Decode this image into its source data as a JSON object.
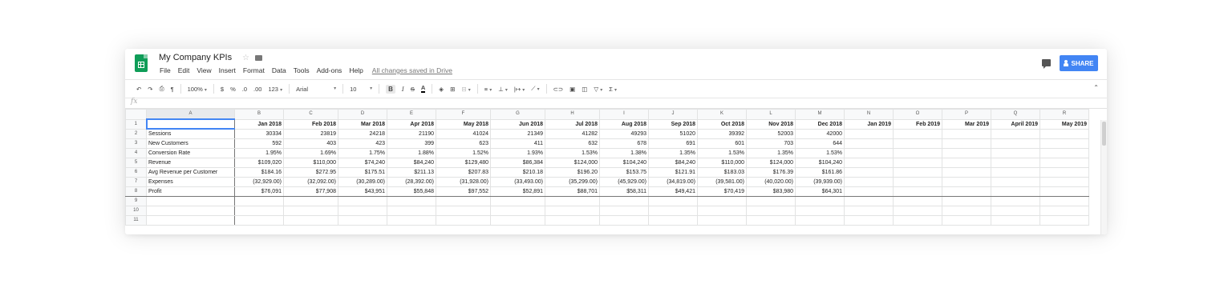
{
  "doc": {
    "title": "My Company KPIs",
    "saved": "All changes saved in Drive"
  },
  "menu": [
    "File",
    "Edit",
    "View",
    "Insert",
    "Format",
    "Data",
    "Tools",
    "Add-ons",
    "Help"
  ],
  "share_label": "SHARE",
  "toolbar": {
    "zoom": "100%",
    "currency": "$",
    "percent": "%",
    "dec_dec": ".0",
    "dec_inc": ".00",
    "more_formats": "123",
    "font": "Arial",
    "font_size": "10",
    "bold": "B",
    "italic": "I",
    "strike": "S",
    "text_color": "A",
    "sum": "Σ"
  },
  "fx_label": "fx",
  "columns": [
    "A",
    "B",
    "C",
    "D",
    "E",
    "F",
    "G",
    "H",
    "I",
    "J",
    "K",
    "L",
    "M",
    "N",
    "O",
    "P",
    "Q",
    "R"
  ],
  "row_numbers": [
    "1",
    "2",
    "3",
    "4",
    "5",
    "6",
    "7",
    "8",
    "9",
    "10",
    "11"
  ],
  "rows": [
    [
      "",
      "Jan 2018",
      "Feb 2018",
      "Mar 2018",
      "Apr 2018",
      "May 2018",
      "Jun 2018",
      "Jul 2018",
      "Aug 2018",
      "Sep 2018",
      "Oct 2018",
      "Nov 2018",
      "Dec 2018",
      "Jan 2019",
      "Feb 2019",
      "Mar 2019",
      "April 2019",
      "May 2019"
    ],
    [
      "Sessions",
      "30334",
      "23819",
      "24218",
      "21190",
      "41024",
      "21349",
      "41282",
      "49293",
      "51020",
      "39392",
      "52003",
      "42000",
      "",
      "",
      "",
      "",
      ""
    ],
    [
      "New Customers",
      "592",
      "403",
      "423",
      "399",
      "623",
      "411",
      "632",
      "678",
      "691",
      "601",
      "703",
      "644",
      "",
      "",
      "",
      "",
      ""
    ],
    [
      "Conversion Rate",
      "1.95%",
      "1.69%",
      "1.75%",
      "1.88%",
      "1.52%",
      "1.93%",
      "1.53%",
      "1.38%",
      "1.35%",
      "1.53%",
      "1.35%",
      "1.53%",
      "",
      "",
      "",
      "",
      ""
    ],
    [
      "Revenue",
      "$109,020",
      "$110,000",
      "$74,240",
      "$84,240",
      "$129,480",
      "$86,384",
      "$124,000",
      "$104,240",
      "$84,240",
      "$110,000",
      "$124,000",
      "$104,240",
      "",
      "",
      "",
      "",
      ""
    ],
    [
      "Avg Revenue per Customer",
      "$184.16",
      "$272.95",
      "$175.51",
      "$211.13",
      "$207.83",
      "$210.18",
      "$196.20",
      "$153.75",
      "$121.91",
      "$183.03",
      "$176.39",
      "$161.86",
      "",
      "",
      "",
      "",
      ""
    ],
    [
      "Expenses",
      "(32,929.00)",
      "(32,092.00)",
      "(30,289.00)",
      "(28,392.00)",
      "(31,928.00)",
      "(33,493.00)",
      "(35,299.00)",
      "(45,929.00)",
      "(34,819.00)",
      "(39,581.00)",
      "(40,020.00)",
      "(39,939.00)",
      "",
      "",
      "",
      "",
      ""
    ],
    [
      "Profit",
      "$76,091",
      "$77,908",
      "$43,951",
      "$55,848",
      "$97,552",
      "$52,891",
      "$88,701",
      "$58,311",
      "$49,421",
      "$70,419",
      "$83,980",
      "$64,301",
      "",
      "",
      "",
      "",
      ""
    ],
    [
      "",
      "",
      "",
      "",
      "",
      "",
      "",
      "",
      "",
      "",
      "",
      "",
      "",
      "",
      "",
      "",
      "",
      ""
    ],
    [
      "",
      "",
      "",
      "",
      "",
      "",
      "",
      "",
      "",
      "",
      "",
      "",
      "",
      "",
      "",
      "",
      "",
      ""
    ],
    [
      "",
      "",
      "",
      "",
      "",
      "",
      "",
      "",
      "",
      "",
      "",
      "",
      "",
      "",
      "",
      "",
      "",
      ""
    ]
  ]
}
